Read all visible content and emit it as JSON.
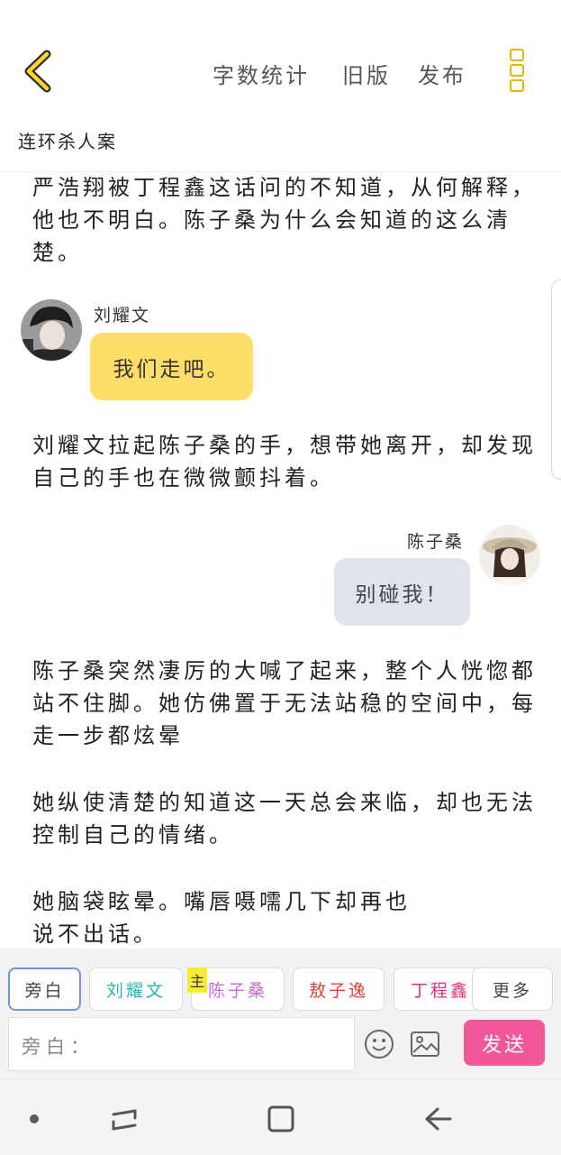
{
  "header": {
    "back_icon": "chevron-left-icon",
    "word_count": "字数统计",
    "old_version": "旧版",
    "publish": "发布",
    "menu_icon": "more-vertical-icon",
    "accent": "#e3b800"
  },
  "title": "连环杀人案",
  "content": {
    "para1": "严浩翔被丁程鑫这话问的不知道，从何解释，他也不明白。陈子桑为什么会知道的这么清楚。",
    "msg1": {
      "speaker": "刘耀文",
      "text": "我们走吧。",
      "bubble_color": "#fede69"
    },
    "para2": "刘耀文拉起陈子桑的手，想带她离开，却发现自己的手也在微微颤抖着。",
    "msg2": {
      "speaker": "陈子桑",
      "text": "别碰我！",
      "bubble_color": "#dfe4ec"
    },
    "para3": "陈子桑突然凄厉的大喊了起来，整个人恍惚都站不住脚。她仿佛置于无法站稳的空间中，每走一步都炫晕",
    "para4": "她纵使清楚的知道这一天总会来临，却也无法控制自己的情绪。",
    "para5": "她脑袋眩晕。嘴唇嗫嚅几下却再也说不出话。"
  },
  "roles": [
    {
      "label": "旁白",
      "color": "#444444",
      "selected": true
    },
    {
      "label": "刘耀文",
      "color": "#2bb6b0"
    },
    {
      "label": "陈子桑",
      "color": "#c86ad8",
      "badge": "主"
    },
    {
      "label": "敖子逸",
      "color": "#e0403c"
    },
    {
      "label": "丁程鑫",
      "color": "#ea2f7a"
    },
    {
      "label": "更多",
      "color": "#444444"
    }
  ],
  "composer": {
    "placeholder": "旁白：",
    "emoji_icon": "emoji-icon",
    "image_icon": "image-icon",
    "send": "发送",
    "send_color": "#f2579a"
  },
  "navbar": {
    "dot_icon": "dot-icon",
    "recents_icon": "recents-icon",
    "home_icon": "home-icon",
    "back_icon": "back-arrow-icon"
  }
}
